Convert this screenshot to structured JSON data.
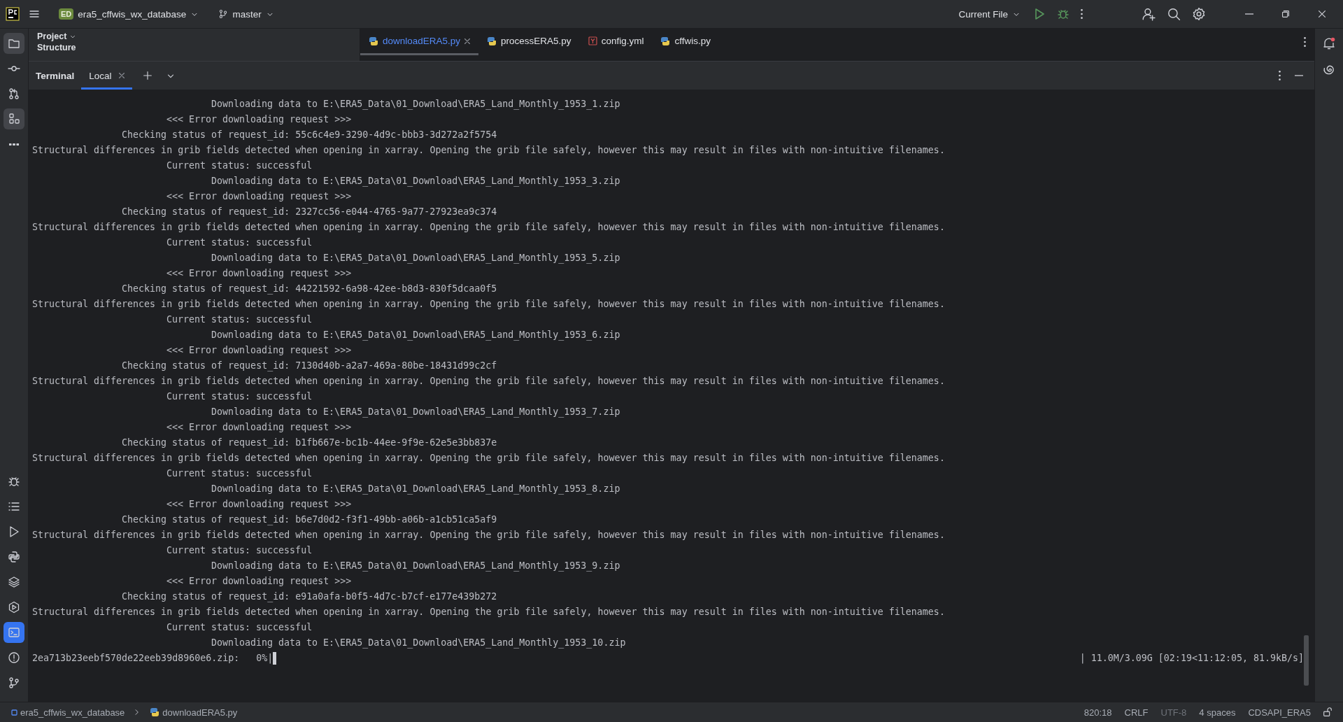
{
  "title_bar": {
    "project_badge": "ED",
    "project_name": "era5_cffwis_wx_database",
    "branch": "master",
    "run_config": "Current File"
  },
  "left_toolbar": {
    "top": [
      {
        "kind": "folder",
        "selected": true
      },
      {
        "kind": "commit",
        "selected": false
      },
      {
        "kind": "pull",
        "selected": false
      },
      {
        "kind": "structure",
        "selected": true
      },
      {
        "kind": "more",
        "selected": false
      }
    ],
    "bottom": [
      {
        "kind": "bug",
        "selected": false
      },
      {
        "kind": "list",
        "selected": false
      },
      {
        "kind": "run",
        "selected": false
      },
      {
        "kind": "python",
        "selected": false
      },
      {
        "kind": "layers",
        "selected": false
      },
      {
        "kind": "services",
        "selected": false
      },
      {
        "kind": "terminal",
        "selected": true
      },
      {
        "kind": "problems",
        "selected": false
      },
      {
        "kind": "git",
        "selected": false
      }
    ]
  },
  "project_panel": {
    "title": "Project",
    "next": "Structure"
  },
  "editor_tabs": [
    {
      "label": "downloadERA5.py",
      "kind": "python",
      "selected": true
    },
    {
      "label": "processERA5.py",
      "kind": "python",
      "selected": false
    },
    {
      "label": "config.yml",
      "kind": "yaml",
      "selected": false
    },
    {
      "label": "cffwis.py",
      "kind": "python",
      "selected": false
    }
  ],
  "terminal": {
    "title": "Terminal",
    "tabs": [
      {
        "label": "Local",
        "selected": true
      }
    ],
    "lines": [
      {
        "kind": "download",
        "text": "Downloading data to E:\\ERA5_Data\\01_Download\\ERA5_Land_Monthly_1953_1.zip"
      },
      {
        "kind": "error",
        "text": "<<< Error downloading request >>>"
      },
      {
        "kind": "checking",
        "text": "Checking status of request_id: 55c6c4e9-3290-4d9c-bbb3-3d272a2f5754"
      },
      {
        "kind": "warning",
        "text": "Structural differences in grib fields detected when opening in xarray. Opening the grib file safely, however this may result in files with non-intuitive filenames."
      },
      {
        "kind": "status",
        "text": "Current status: successful"
      },
      {
        "kind": "download",
        "text": "Downloading data to E:\\ERA5_Data\\01_Download\\ERA5_Land_Monthly_1953_3.zip"
      },
      {
        "kind": "error",
        "text": "<<< Error downloading request >>>"
      },
      {
        "kind": "checking",
        "text": "Checking status of request_id: 2327cc56-e044-4765-9a77-27923ea9c374"
      },
      {
        "kind": "warning",
        "text": "Structural differences in grib fields detected when opening in xarray. Opening the grib file safely, however this may result in files with non-intuitive filenames."
      },
      {
        "kind": "status",
        "text": "Current status: successful"
      },
      {
        "kind": "download",
        "text": "Downloading data to E:\\ERA5_Data\\01_Download\\ERA5_Land_Monthly_1953_5.zip"
      },
      {
        "kind": "error",
        "text": "<<< Error downloading request >>>"
      },
      {
        "kind": "checking",
        "text": "Checking status of request_id: 44221592-6a98-42ee-b8d3-830f5dcaa0f5"
      },
      {
        "kind": "warning",
        "text": "Structural differences in grib fields detected when opening in xarray. Opening the grib file safely, however this may result in files with non-intuitive filenames."
      },
      {
        "kind": "status",
        "text": "Current status: successful"
      },
      {
        "kind": "download",
        "text": "Downloading data to E:\\ERA5_Data\\01_Download\\ERA5_Land_Monthly_1953_6.zip"
      },
      {
        "kind": "error",
        "text": "<<< Error downloading request >>>"
      },
      {
        "kind": "checking",
        "text": "Checking status of request_id: 7130d40b-a2a7-469a-80be-18431d99c2cf"
      },
      {
        "kind": "warning",
        "text": "Structural differences in grib fields detected when opening in xarray. Opening the grib file safely, however this may result in files with non-intuitive filenames."
      },
      {
        "kind": "status",
        "text": "Current status: successful"
      },
      {
        "kind": "download",
        "text": "Downloading data to E:\\ERA5_Data\\01_Download\\ERA5_Land_Monthly_1953_7.zip"
      },
      {
        "kind": "error",
        "text": "<<< Error downloading request >>>"
      },
      {
        "kind": "checking",
        "text": "Checking status of request_id: b1fb667e-bc1b-44ee-9f9e-62e5e3bb837e"
      },
      {
        "kind": "warning",
        "text": "Structural differences in grib fields detected when opening in xarray. Opening the grib file safely, however this may result in files with non-intuitive filenames."
      },
      {
        "kind": "status",
        "text": "Current status: successful"
      },
      {
        "kind": "download",
        "text": "Downloading data to E:\\ERA5_Data\\01_Download\\ERA5_Land_Monthly_1953_8.zip"
      },
      {
        "kind": "error",
        "text": "<<< Error downloading request >>>"
      },
      {
        "kind": "checking",
        "text": "Checking status of request_id: b6e7d0d2-f3f1-49bb-a06b-a1cb51ca5af9"
      },
      {
        "kind": "warning",
        "text": "Structural differences in grib fields detected when opening in xarray. Opening the grib file safely, however this may result in files with non-intuitive filenames."
      },
      {
        "kind": "status",
        "text": "Current status: successful"
      },
      {
        "kind": "download",
        "text": "Downloading data to E:\\ERA5_Data\\01_Download\\ERA5_Land_Monthly_1953_9.zip"
      },
      {
        "kind": "error",
        "text": "<<< Error downloading request >>>"
      },
      {
        "kind": "checking",
        "text": "Checking status of request_id: e91a0afa-b0f5-4d7c-b7cf-e177e439b272"
      },
      {
        "kind": "warning",
        "text": "Structural differences in grib fields detected when opening in xarray. Opening the grib file safely, however this may result in files with non-intuitive filenames."
      },
      {
        "kind": "status",
        "text": "Current status: successful"
      },
      {
        "kind": "download",
        "text": "Downloading data to E:\\ERA5_Data\\01_Download\\ERA5_Land_Monthly_1953_10.zip"
      }
    ],
    "progress_left": "2ea713b23eebf570de22eeb39d8960e6.zip:   0%|",
    "progress_right": "| 11.0M/3.09G [02:19<11:12:05, 81.9kB/s]"
  },
  "status_bar": {
    "breadcrumbs": [
      {
        "label": "era5_cffwis_wx_database",
        "kind": "project"
      },
      {
        "label": "downloadERA5.py",
        "kind": "python"
      }
    ],
    "items": [
      {
        "label": "820:18",
        "disabled": false
      },
      {
        "label": "CRLF",
        "disabled": false
      },
      {
        "label": "UTF-8",
        "disabled": true
      },
      {
        "label": "4 spaces",
        "disabled": false
      },
      {
        "label": "CDSAPI_ERA5",
        "disabled": false
      }
    ]
  }
}
